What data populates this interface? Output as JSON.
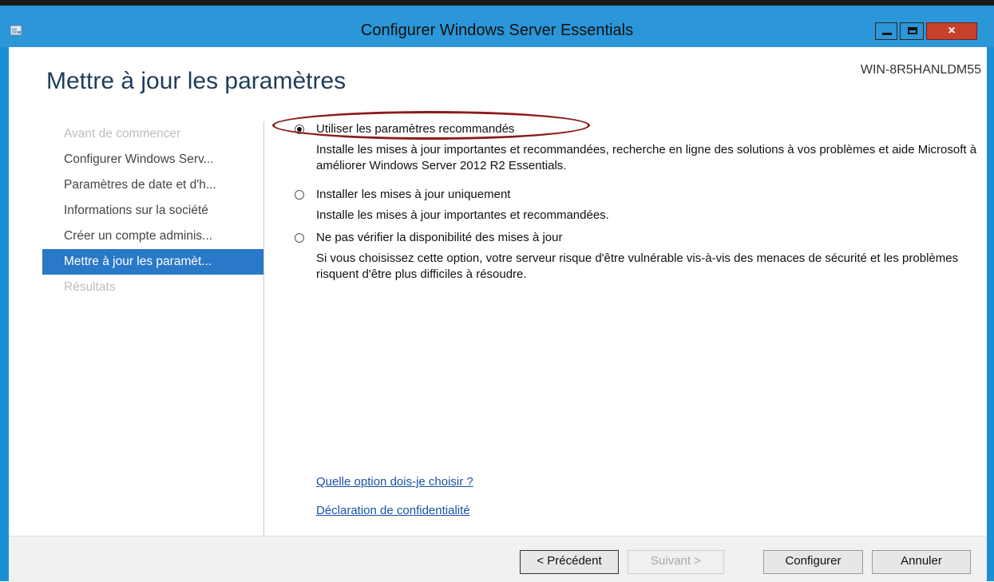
{
  "window": {
    "title": "Configurer Windows Server Essentials",
    "close_glyph": "×",
    "accent_color": "#2b96d8",
    "close_color": "#c7402c"
  },
  "server_name": "WIN-8R5HANLDM55",
  "page_title": "Mettre à jour les paramètres",
  "sidebar": {
    "items": [
      {
        "label": "Avant de commencer",
        "state": "disabled"
      },
      {
        "label": "Configurer Windows Serv...",
        "state": "normal"
      },
      {
        "label": "Paramètres de date et d'h...",
        "state": "normal"
      },
      {
        "label": "Informations sur la société",
        "state": "normal"
      },
      {
        "label": "Créer un compte adminis...",
        "state": "normal"
      },
      {
        "label": "Mettre à jour les paramèt...",
        "state": "active"
      },
      {
        "label": "Résultats",
        "state": "disabled"
      }
    ]
  },
  "options": [
    {
      "label": "Utiliser les paramètres recommandés",
      "description": "Installe les mises à jour importantes et recommandées, recherche en ligne des solutions à vos problèmes et aide Microsoft à améliorer Windows Server 2012 R2 Essentials.",
      "selected": true
    },
    {
      "label": "Installer les mises à jour uniquement",
      "description": "Installe les mises à jour importantes et recommandées.",
      "selected": false
    },
    {
      "label": "Ne pas vérifier la disponibilité des mises à jour",
      "description": "Si vous choisissez cette option, votre serveur risque d'être vulnérable vis-à-vis des menaces de sécurité et les problèmes risquent d'être plus difficiles à résoudre.",
      "selected": false
    }
  ],
  "links": {
    "which_option": "Quelle option dois-je choisir ?",
    "privacy": "Déclaration de confidentialité"
  },
  "buttons": {
    "previous": "< Précédent",
    "next": "Suivant >",
    "configure": "Configurer",
    "cancel": "Annuler"
  }
}
